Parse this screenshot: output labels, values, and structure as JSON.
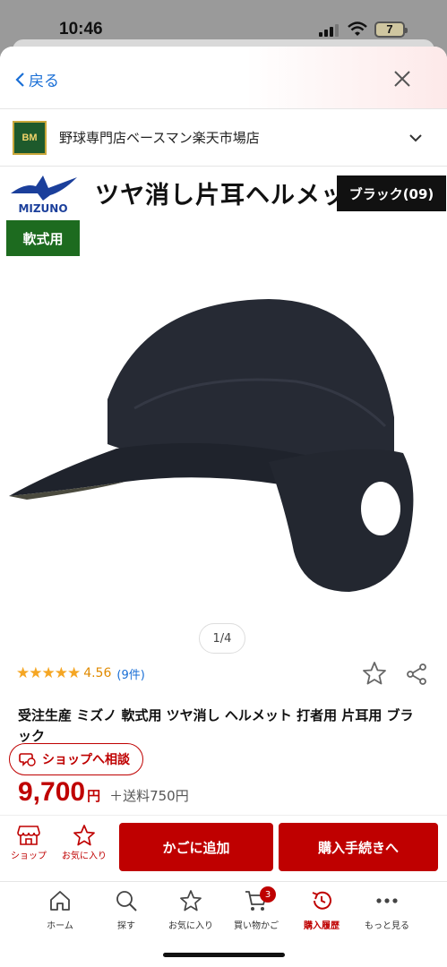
{
  "status_bar": {
    "time": "10:46",
    "battery": "7"
  },
  "header": {
    "back_label": "戻る"
  },
  "shop": {
    "name": "野球専門店ベースマン楽天市場店",
    "logo_text": "BM"
  },
  "product_image": {
    "brand_logo_text": "MIZUNO",
    "title": "ツヤ消し片耳ヘルメット",
    "color_label": "ブラック(09)",
    "type_label": "軟式用",
    "pager": "1/4"
  },
  "rating": {
    "stars": "★★★★★",
    "score": "4.56",
    "count": "(9件)"
  },
  "product": {
    "title": "受注生産 ミズノ 軟式用 ツヤ消し ヘルメット 打者用 片耳用 ブラック",
    "consult_label": "ショップへ相談",
    "price": "9,700",
    "yen": "円",
    "shipping": "＋送料750円"
  },
  "actions": {
    "shop_label": "ショップ",
    "favorite_label": "お気に入り",
    "add_cart_label": "かごに追加",
    "buy_label": "購入手続きへ"
  },
  "nav": {
    "items": [
      {
        "label": "ホーム",
        "icon": "home-icon"
      },
      {
        "label": "探す",
        "icon": "search-icon"
      },
      {
        "label": "お気に入り",
        "icon": "star-icon"
      },
      {
        "label": "買い物かご",
        "icon": "cart-icon"
      },
      {
        "label": "購入履歴",
        "icon": "history-icon"
      },
      {
        "label": "もっと見る",
        "icon": "more-icon"
      }
    ],
    "cart_badge": "3"
  },
  "colors": {
    "accent": "#bf0000",
    "link": "#1a6fd6",
    "star": "#f5a623",
    "tag_green": "#1d6b1f"
  }
}
